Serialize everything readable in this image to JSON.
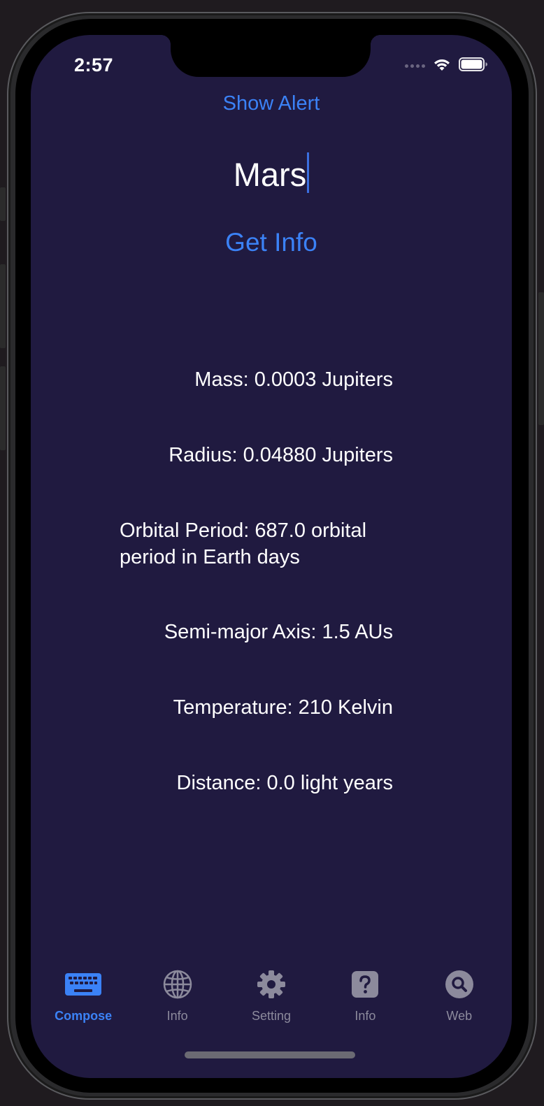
{
  "status_bar": {
    "time": "2:57"
  },
  "main": {
    "show_alert_label": "Show Alert",
    "planet_input_value": "Mars",
    "get_info_label": "Get Info",
    "info_lines": {
      "mass": "Mass: 0.0003 Jupiters",
      "radius": "Radius: 0.04880 Jupiters",
      "orbital_period": "Orbital Period: 687.0 orbital period in Earth days",
      "semi_major_axis": "Semi-major Axis: 1.5 AUs",
      "temperature": "Temperature: 210 Kelvin",
      "distance": "Distance: 0.0 light years"
    }
  },
  "tab_bar": {
    "active_color": "#3b82f6",
    "inactive_color": "#8c8a9c",
    "tabs": [
      {
        "label": "Compose",
        "icon": "keyboard-icon",
        "active": true
      },
      {
        "label": "Info",
        "icon": "globe-icon",
        "active": false
      },
      {
        "label": "Setting",
        "icon": "gear-icon",
        "active": false
      },
      {
        "label": "Info",
        "icon": "question-icon",
        "active": false
      },
      {
        "label": "Web",
        "icon": "search-icon",
        "active": false
      }
    ]
  },
  "colors": {
    "background": "#201a40",
    "accent": "#3b82f6",
    "text": "#ffffff"
  }
}
